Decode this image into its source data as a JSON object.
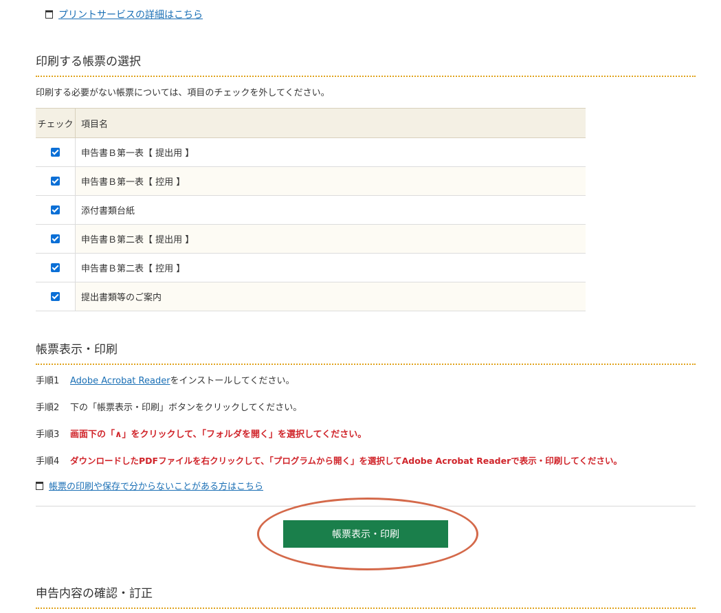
{
  "print_service": {
    "link_label": "プリントサービスの詳細はこちら"
  },
  "select_section": {
    "title": "印刷する帳票の選択",
    "note": "印刷する必要がない帳票については、項目のチェックを外してください。",
    "columns": {
      "check": "チェック",
      "name": "項目名"
    },
    "rows": [
      {
        "name": "申告書Ｂ第一表【 提出用 】",
        "checked": true
      },
      {
        "name": "申告書Ｂ第一表【 控用 】",
        "checked": true
      },
      {
        "name": "添付書類台紙",
        "checked": true
      },
      {
        "name": "申告書Ｂ第二表【 提出用 】",
        "checked": true
      },
      {
        "name": "申告書Ｂ第二表【 控用 】",
        "checked": true
      },
      {
        "name": "提出書類等のご案内",
        "checked": true
      }
    ]
  },
  "display_section": {
    "title": "帳票表示・印刷",
    "steps": [
      {
        "num": "手順1",
        "link": "Adobe Acrobat Reader",
        "text": "をインストールしてください。",
        "emphasis": false
      },
      {
        "num": "手順2",
        "link": "",
        "text": "下の「帳票表示・印刷」ボタンをクリックしてください。",
        "emphasis": false
      },
      {
        "num": "手順3",
        "link": "",
        "text": "画面下の「∧」をクリックして、「フォルダを開く」を選択してください。",
        "emphasis": true
      },
      {
        "num": "手順4",
        "link": "",
        "text": "ダウンロードしたPDFファイルを右クリックして、「プログラムから開く」を選択してAdobe Acrobat Readerで表示・印刷してください。",
        "emphasis": true
      }
    ],
    "help_link_label": "帳票の印刷や保存で分からないことがある方はこちら",
    "button_label": "帳票表示・印刷"
  },
  "confirm_section": {
    "title": "申告内容の確認・訂正"
  },
  "colors": {
    "link": "#1a6fb5",
    "accent_dotted": "#e0a21a",
    "emphasis_red": "#d0252b",
    "primary_button": "#1a7f4b",
    "highlight_ellipse": "#d4694a",
    "checkbox": "#0b6fd6"
  }
}
